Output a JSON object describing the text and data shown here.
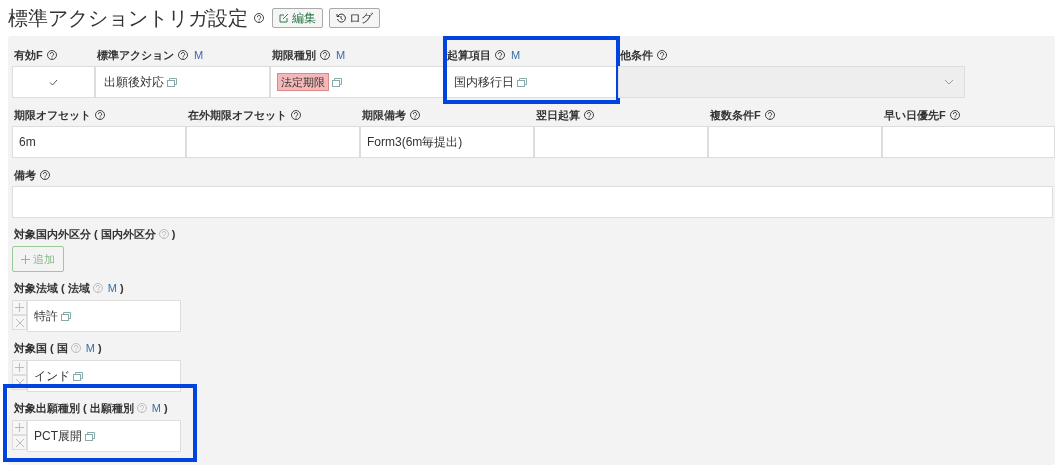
{
  "title": "標準アクショントリガ設定",
  "title_buttons": [
    {
      "label": "編集",
      "kind": "edit"
    },
    {
      "label": "ログ",
      "kind": "log"
    }
  ],
  "rows": [
    {
      "fields": [
        {
          "label": "有効F",
          "kind": "check",
          "checked": true,
          "highlighted": false
        },
        {
          "label": "標準アクション",
          "marker": "M",
          "kind": "link",
          "value": "出願後対応",
          "highlighted": false
        },
        {
          "label": "期限種別",
          "marker": "M",
          "kind": "tag",
          "value": "法定期限",
          "highlighted": false
        },
        {
          "label": "起算項目",
          "marker": "M",
          "kind": "link",
          "value": "国内移行日",
          "highlighted": true
        },
        {
          "label": "他条件",
          "kind": "select",
          "highlighted": false
        }
      ]
    },
    {
      "fields": [
        {
          "label": "期限オフセット",
          "kind": "text",
          "value": "6m",
          "highlighted": false
        },
        {
          "label": "在外期限オフセット",
          "kind": "text",
          "highlighted": false
        },
        {
          "label": "期限備考",
          "kind": "text",
          "value": "Form3(6m毎提出)",
          "highlighted": false
        },
        {
          "label": "翌日起算",
          "kind": "text",
          "highlighted": false
        },
        {
          "label": "複数条件F",
          "kind": "text",
          "highlighted": false
        },
        {
          "label": "早い日優先F",
          "kind": "text",
          "highlighted": false
        }
      ]
    },
    {
      "fields": [
        {
          "label": "備考",
          "kind": "text",
          "highlighted": false
        }
      ]
    }
  ],
  "lists": [
    {
      "label": "対象国内外区分 ( 国内外区分",
      "close": ")",
      "add_button": "追加",
      "highlighted": false
    },
    {
      "label": "対象法域 ( 法域",
      "close": ")",
      "marker": "M",
      "items": [
        "特許"
      ],
      "highlighted": false
    },
    {
      "label": "対象国 ( 国",
      "close": ")",
      "marker": "M",
      "items": [
        "インド"
      ],
      "highlighted": false
    },
    {
      "label": "対象出願種別 ( 出願種別",
      "close": ")",
      "marker": "M",
      "items": [
        "PCT展開"
      ],
      "highlighted": true
    }
  ]
}
